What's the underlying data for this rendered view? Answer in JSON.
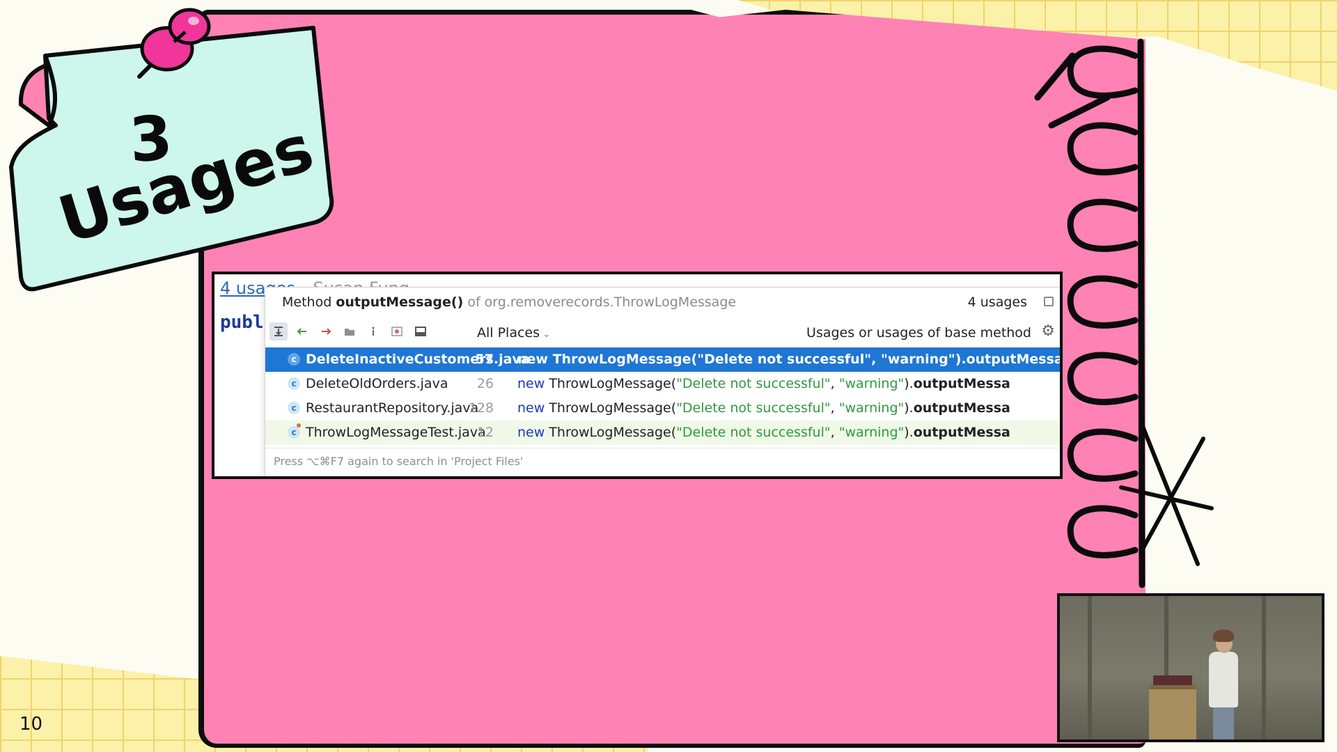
{
  "slide": {
    "number": "10",
    "note_line1": "3",
    "note_line2": "Usages"
  },
  "colors": {
    "pink_panel": "#ff82b4",
    "note_mint": "#cdf7ec",
    "note_corner": "#ff83b2",
    "pin": "#f0369a",
    "selection": "#1f76d4",
    "keyword": "#1a3bb5",
    "string": "#2e9a3d"
  },
  "editor": {
    "usage_hint": "4 usages",
    "author": "Susan Fung",
    "code_prefix": "publ"
  },
  "popup": {
    "title_prefix": "Method",
    "method_name": "outputMessage()",
    "class_path": "of org.removerecords.ThrowLogMessage",
    "usage_count": "4 usages",
    "scope": "All Places",
    "filter_label": "Usages or usages of base method",
    "footer": "Press ⌥⌘F7 again to search in 'Project Files'",
    "toolbar_icons": [
      "merge-usages-icon",
      "previous-occurrence-icon",
      "next-occurrence-icon",
      "group-by-directory-icon",
      "info-icon",
      "method-filter-icon",
      "preview-panel-icon"
    ],
    "results": [
      {
        "file": "DeleteInactiveCustomers.java",
        "line": "57",
        "kw": "new",
        "cls": "ThrowLogMessage(",
        "arg1": "\"Delete not successful\"",
        "sep": ", ",
        "arg2": "\"warning\"",
        "close": ").",
        "method": "outputMessa"
      },
      {
        "file": "DeleteOldOrders.java",
        "line": "26",
        "kw": "new",
        "cls": "ThrowLogMessage(",
        "arg1": "\"Delete not successful\"",
        "sep": ", ",
        "arg2": "\"warning\"",
        "close": ").",
        "method": "outputMessa"
      },
      {
        "file": "RestaurantRepository.java",
        "line": "128",
        "kw": "new",
        "cls": "ThrowLogMessage(",
        "arg1": "\"Delete not successful\"",
        "sep": ", ",
        "arg2": "\"warning\"",
        "close": ").",
        "method": "outputMessa"
      },
      {
        "file": "ThrowLogMessageTest.java",
        "line": "12",
        "kw": "new",
        "cls": "ThrowLogMessage(",
        "arg1": "\"Delete not successful\"",
        "sep": ", ",
        "arg2": "\"warning\"",
        "close": ").",
        "method": "outputMessa"
      }
    ]
  }
}
